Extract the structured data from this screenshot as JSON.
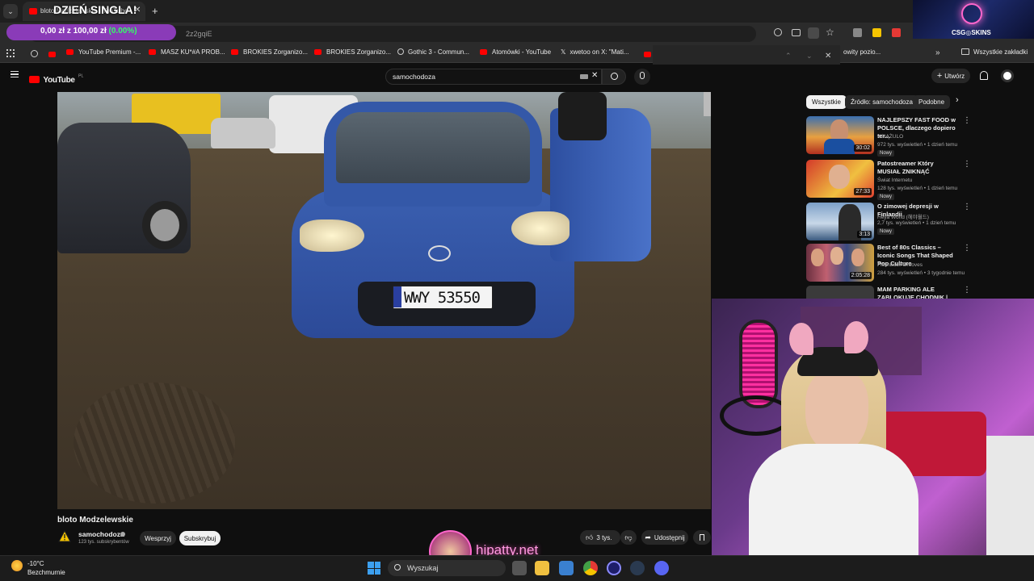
{
  "browser": {
    "tab_title": "bloto Modzelewskie - YouTube",
    "new_tab": "+",
    "url_fragment": "2z2gqiE",
    "bookmarks": [
      {
        "label": "YouTube Premium -...",
        "icon": "youtube-icon"
      },
      {
        "label": "MASZ KU*#A PROB...",
        "icon": "youtube-icon"
      },
      {
        "label": "BROKIES Zorganizo...",
        "icon": "youtube-icon"
      },
      {
        "label": "BROKIES Zorganizo...",
        "icon": "youtube-icon"
      },
      {
        "label": "Gothic 3 - Commun...",
        "icon": "globe-icon"
      },
      {
        "label": "Atomówki - YouTube",
        "icon": "youtube-icon"
      },
      {
        "label": "xwetoo on X: \"Mati...",
        "icon": "x-icon"
      }
    ],
    "bookmark_overflow": "owity pozio...",
    "all_bookmarks": "Wszystkie zakładki"
  },
  "overlay": {
    "banner": "DZIEŃ SINGLA!",
    "goal_current": "0,00 zł",
    "goal_sep": "z",
    "goal_target": "100,00 zł",
    "goal_pct": "(0.00%)",
    "sponsor": "CSG◎SKINS",
    "watermark": "hipatty.net"
  },
  "youtube": {
    "logo": "YouTube",
    "region": "PL",
    "search_query": "samochodoza",
    "create_label": "Utwórz",
    "chips": [
      "Wszystkie",
      "Źródło: samochodoza",
      "Podobne"
    ],
    "video": {
      "title": "bloto Modzelewskie",
      "plate": "WWY 53550",
      "channel": "samochodoza",
      "subs": "123 tys. subskrybentów",
      "support_label": "Wesprzyj",
      "subscribe_label": "Subskrybuj",
      "likes": "3 tys.",
      "share_label": "Udostępnij"
    },
    "recommendations": [
      {
        "title": "NAJLEPSZY FAST FOOD w POLSCE, dlaczego dopiero ter...",
        "channel": "KSIĄŻULO",
        "meta": "972 tys. wyświetleń • 1 dzień temu",
        "badge": "Nowy",
        "duration": "30:02"
      },
      {
        "title": "Patostreamer Który MUSIAŁ ZNIKNĄĆ",
        "channel": "Świat Internetu",
        "meta": "128 tys. wyświetleń • 1 dzień temu",
        "badge": "Nowy",
        "duration": "27:33"
      },
      {
        "title": "O zimowej depresji w Finlandii",
        "channel": "Heya World (헤야월드)",
        "meta": "2,7 tys. wyświetleń • 1 dzień temu",
        "badge": "Nowy",
        "duration": "3:13"
      },
      {
        "title": "Best of 80s Classics – Iconic Songs That Shaped Pop Culture",
        "channel": "Flashback Grooves",
        "meta": "284 tys. wyświetleń • 3 tygodnie temu",
        "badge": "",
        "duration": "2:05:28"
      },
      {
        "title": "MAM PARKING ALE ZABLOKUJE CHODNIK | ODC.1",
        "channel": "",
        "meta": "",
        "badge": "",
        "duration": ""
      }
    ]
  },
  "taskbar": {
    "temperature": "-10°C",
    "weather": "Bezchmurnie",
    "search_placeholder": "Wyszukaj"
  },
  "colors": {
    "accent": "#ff0000",
    "goal_pill": "#8a3bb8",
    "goal_pct": "#33ff66"
  }
}
